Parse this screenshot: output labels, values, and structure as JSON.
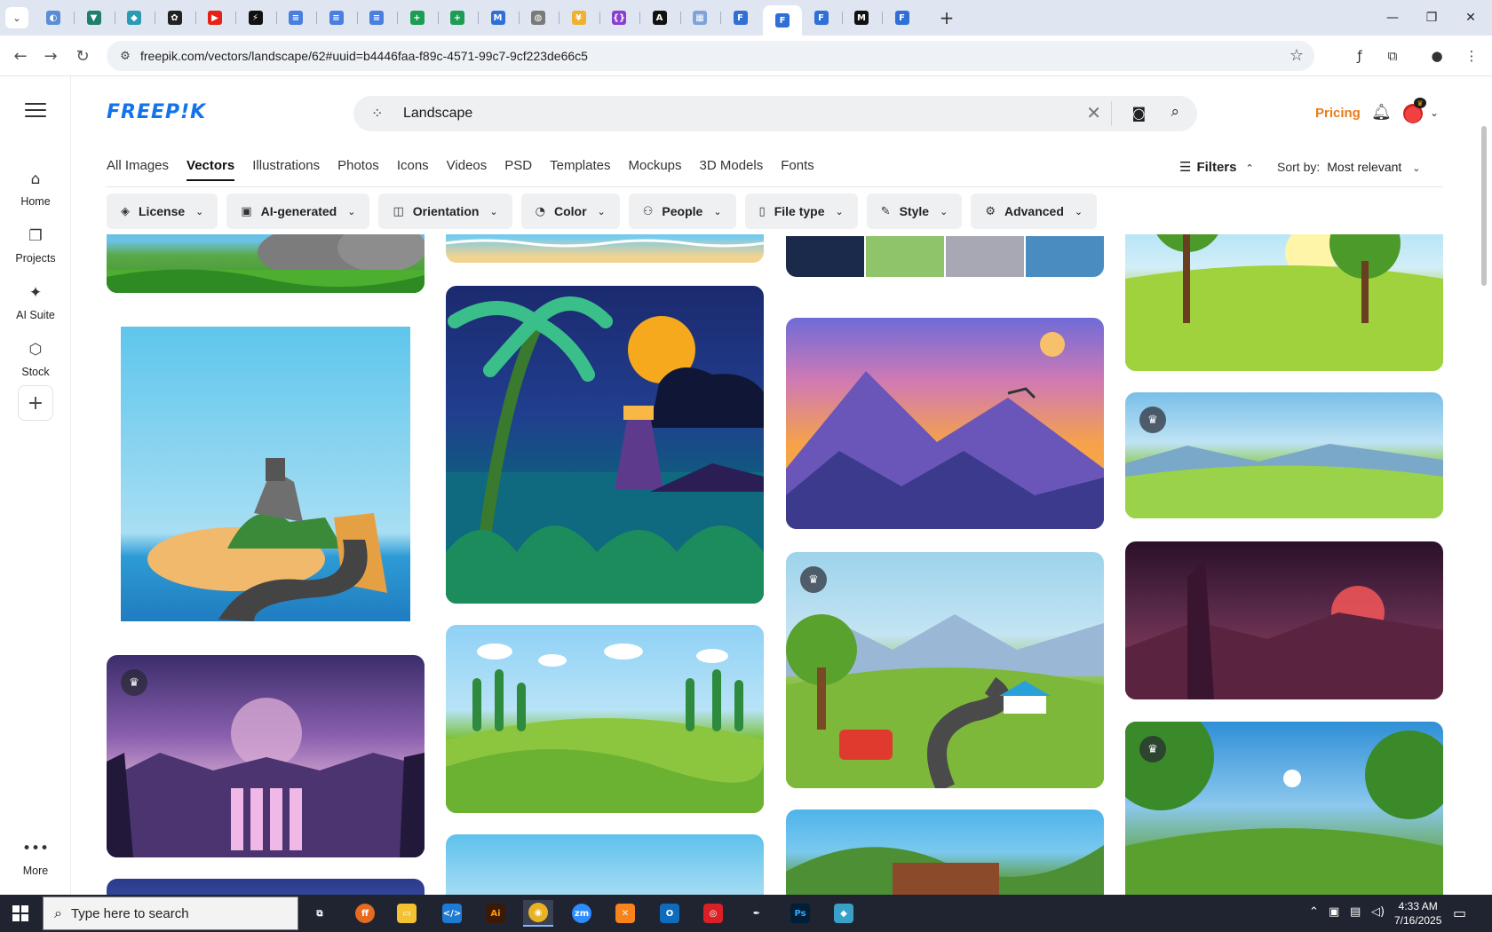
{
  "browser": {
    "url": "freepik.com/vectors/landscape/62#uuid=b4446faa-f89c-4571-99c7-9cf223de66c5",
    "tabs": [
      {
        "icon": "globe-icon",
        "color": "#5b8dd6",
        "glyph": "◐"
      },
      {
        "icon": "vpn-icon",
        "color": "#1e7f6e",
        "glyph": "▼"
      },
      {
        "icon": "app-icon",
        "color": "#2b9bb3",
        "glyph": "◆"
      },
      {
        "icon": "openai-icon",
        "color": "#222222",
        "glyph": "✿"
      },
      {
        "icon": "youtube-icon",
        "color": "#e62117",
        "glyph": "▶"
      },
      {
        "icon": "bolt-icon",
        "color": "#111111",
        "glyph": "⚡"
      },
      {
        "icon": "docs-icon",
        "color": "#4a7fe0",
        "glyph": "≡"
      },
      {
        "icon": "docs-icon",
        "color": "#4a7fe0",
        "glyph": "≡"
      },
      {
        "icon": "docs-icon",
        "color": "#4a7fe0",
        "glyph": "≡"
      },
      {
        "icon": "sheets-icon",
        "color": "#1e9c54",
        "glyph": "+"
      },
      {
        "icon": "sheets-icon",
        "color": "#1e9c54",
        "glyph": "+"
      },
      {
        "icon": "app-icon",
        "color": "#2f6fd6",
        "glyph": "M"
      },
      {
        "icon": "globe-icon",
        "color": "#7a7a7a",
        "glyph": "◍"
      },
      {
        "icon": "app-icon",
        "color": "#f0b030",
        "glyph": "¥"
      },
      {
        "icon": "code-icon",
        "color": "#8a3fd1",
        "glyph": "{}"
      },
      {
        "icon": "app-icon",
        "color": "#111111",
        "glyph": "A"
      },
      {
        "icon": "app-icon",
        "color": "#7fa3d9",
        "glyph": "▦"
      },
      {
        "icon": "app-icon",
        "color": "#2f6fd6",
        "glyph": "F"
      },
      {
        "icon": "app-icon",
        "color": "#2f6fd6",
        "glyph": "F"
      },
      {
        "icon": "app-icon",
        "color": "#2f6fd6",
        "glyph": "F"
      },
      {
        "icon": "app-icon",
        "color": "#111111",
        "glyph": "M"
      },
      {
        "icon": "app-icon",
        "color": "#2f6fd6",
        "glyph": "F"
      }
    ]
  },
  "rail": {
    "items": [
      {
        "label": "Home",
        "icon": "home-icon",
        "glyph": "⌂"
      },
      {
        "label": "Projects",
        "icon": "projects-icon",
        "glyph": "❐"
      },
      {
        "label": "AI Suite",
        "icon": "ai-suite-icon",
        "glyph": "✦"
      },
      {
        "label": "Stock",
        "icon": "stock-icon",
        "glyph": "⬡"
      }
    ],
    "more_label": "More"
  },
  "header": {
    "logo": "FREEP!K",
    "search_value": "Landscape",
    "pricing": "Pricing"
  },
  "categories": [
    "All Images",
    "Vectors",
    "Illustrations",
    "Photos",
    "Icons",
    "Videos",
    "PSD",
    "Templates",
    "Mockups",
    "3D Models",
    "Fonts"
  ],
  "active_category": "Vectors",
  "filters_label": "Filters",
  "sort": {
    "label": "Sort by:",
    "value": "Most relevant"
  },
  "pills": [
    {
      "label": "License",
      "icon": "license-icon",
      "glyph": "◈"
    },
    {
      "label": "AI-generated",
      "icon": "ai-icon",
      "glyph": "▣"
    },
    {
      "label": "Orientation",
      "icon": "orientation-icon",
      "glyph": "◫"
    },
    {
      "label": "Color",
      "icon": "palette-icon",
      "glyph": "◔"
    },
    {
      "label": "People",
      "icon": "people-icon",
      "glyph": "⚇"
    },
    {
      "label": "File type",
      "icon": "file-icon",
      "glyph": "▯"
    },
    {
      "label": "Style",
      "icon": "brush-icon",
      "glyph": "✎"
    },
    {
      "label": "Advanced",
      "icon": "settings-icon",
      "glyph": "⚙"
    }
  ],
  "taskbar": {
    "search_placeholder": "Type here to search",
    "time": "4:33 AM",
    "date": "7/16/2025"
  }
}
